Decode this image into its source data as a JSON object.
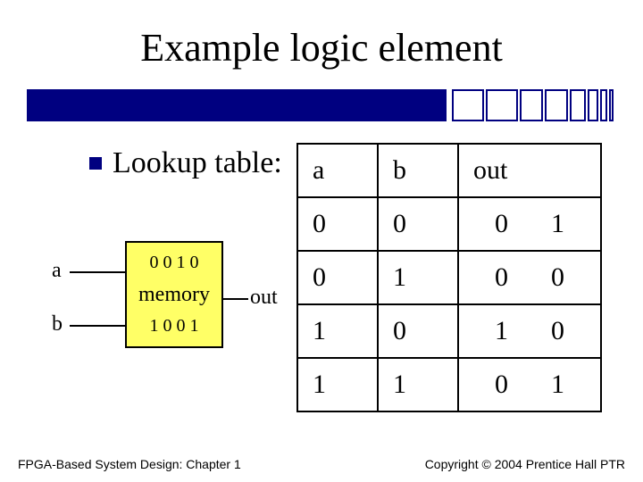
{
  "title": "Example logic element",
  "bullet": "Lookup table:",
  "memory": {
    "top_bits": "0 0 1 0",
    "label": "memory",
    "bottom_bits": "1 0 0 1"
  },
  "wires": {
    "a": "a",
    "b": "b",
    "out": "out"
  },
  "truth_table": {
    "headers": {
      "a": "a",
      "b": "b",
      "out": "out"
    },
    "rows": [
      {
        "a": "0",
        "b": "0",
        "o1": "0",
        "o2": "1"
      },
      {
        "a": "0",
        "b": "1",
        "o1": "0",
        "o2": "0"
      },
      {
        "a": "1",
        "b": "0",
        "o1": "1",
        "o2": "0"
      },
      {
        "a": "1",
        "b": "1",
        "o1": "0",
        "o2": "1"
      }
    ]
  },
  "footer": {
    "left": "FPGA-Based System Design: Chapter 1",
    "right": "Copyright © 2004 Prentice Hall PTR"
  }
}
